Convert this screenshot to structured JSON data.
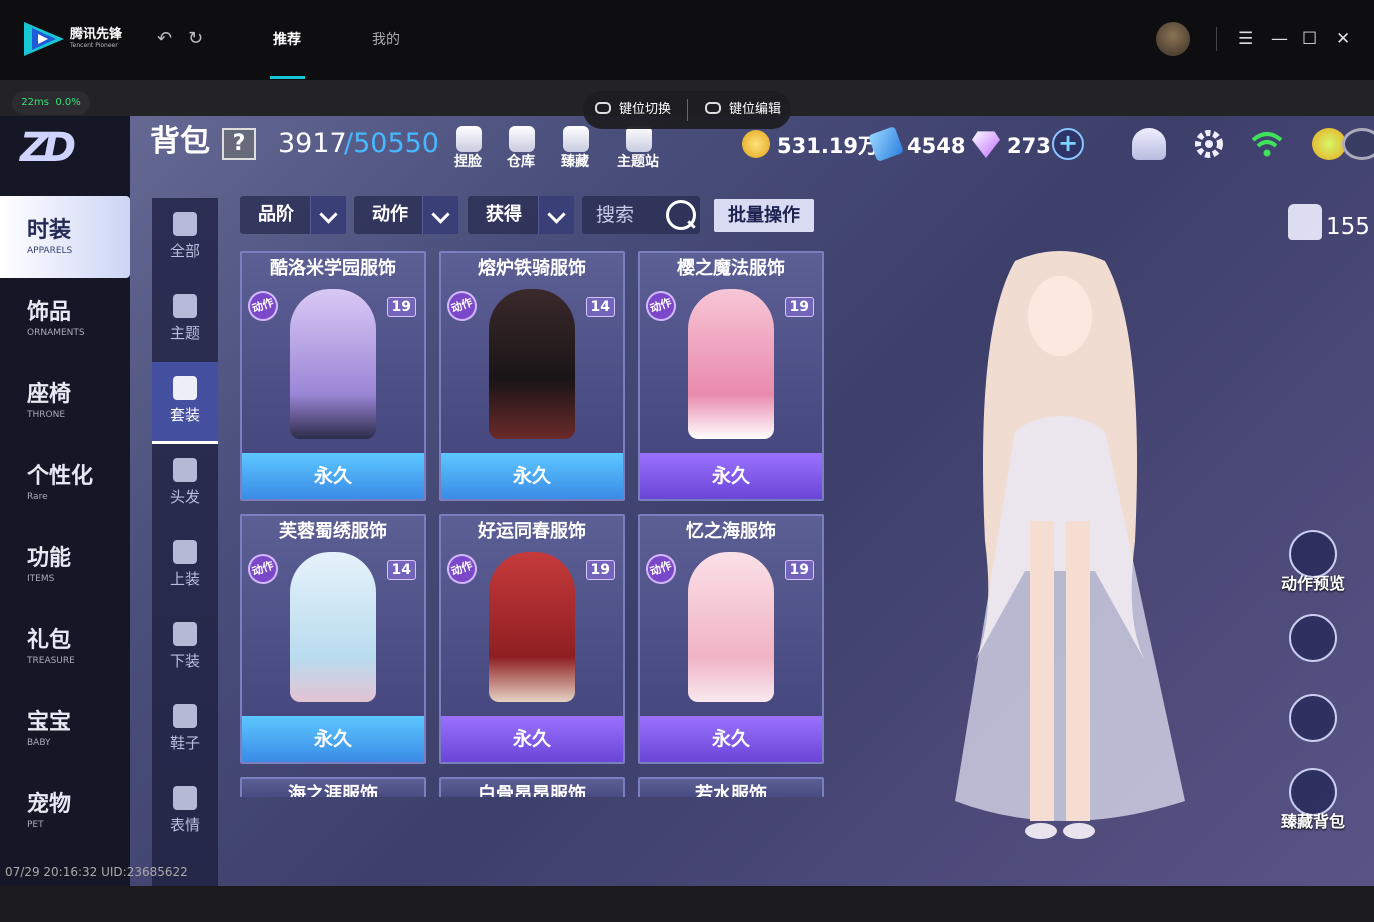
{
  "window": {
    "app_name": "腾讯先锋",
    "app_name_en": "Tencent Pioneer",
    "tabs": [
      {
        "label": "推荐"
      },
      {
        "label": "我的"
      }
    ],
    "ping": "22ms",
    "loss": "0.0%",
    "keymap": {
      "switch_label": "键位切换",
      "edit_label": "键位编辑"
    }
  },
  "game": {
    "bag_title": "背包",
    "help": "?",
    "capacity_used": "3917",
    "capacity_total": "/50550",
    "top_icons": [
      {
        "label": "捏脸"
      },
      {
        "label": "仓库"
      },
      {
        "label": "臻藏"
      },
      {
        "label": "主题站"
      }
    ],
    "currency": {
      "gold": "531.19万",
      "coupon": "4548",
      "diamond": "273",
      "plus": "+"
    },
    "categories": [
      {
        "zh": "时装",
        "en": "APPARELS"
      },
      {
        "zh": "饰品",
        "en": "ORNAMENTS"
      },
      {
        "zh": "座椅",
        "en": "THRONE"
      },
      {
        "zh": "个性化",
        "en": "Rare"
      },
      {
        "zh": "功能",
        "en": "ITEMS"
      },
      {
        "zh": "礼包",
        "en": "TREASURE"
      },
      {
        "zh": "宝宝",
        "en": "BABY"
      },
      {
        "zh": "宠物",
        "en": "PET"
      }
    ],
    "subnav": [
      {
        "label": "全部"
      },
      {
        "label": "主题"
      },
      {
        "label": "套装"
      },
      {
        "label": "头发"
      },
      {
        "label": "上装"
      },
      {
        "label": "下装"
      },
      {
        "label": "鞋子"
      },
      {
        "label": "表情"
      }
    ],
    "filters": [
      {
        "label": "品阶"
      },
      {
        "label": "动作"
      },
      {
        "label": "获得"
      }
    ],
    "search_placeholder": "搜索",
    "batch_label": "批量操作",
    "items": [
      {
        "name": "酷洛米学园服饰",
        "badge": "动作",
        "level": "19",
        "perm": "永久",
        "color": "#b9a6e8"
      },
      {
        "name": "熔炉铁骑服饰",
        "badge": "动作",
        "level": "14",
        "perm": "永久",
        "color": "#2a2224"
      },
      {
        "name": "樱之魔法服饰",
        "badge": "动作",
        "level": "19",
        "perm": "永久",
        "color": "#f2a7c0"
      },
      {
        "name": "芙蓉蜀绣服饰",
        "badge": "动作",
        "level": "14",
        "perm": "永久",
        "color": "#cfe6f2"
      },
      {
        "name": "好运同春服饰",
        "badge": "动作",
        "level": "19",
        "perm": "永久",
        "color": "#b22a2a"
      },
      {
        "name": "忆之海服饰",
        "badge": "动作",
        "level": "19",
        "perm": "永久",
        "color": "#f4c8d6"
      },
      {
        "name": "海之涯服饰"
      },
      {
        "name": "白骨昂昂服饰"
      },
      {
        "name": "若水服饰"
      }
    ],
    "outfit_count": "155",
    "side_buttons": [
      {
        "label": "动作预览"
      },
      {
        "label": ""
      },
      {
        "label": ""
      },
      {
        "label": "臻藏背包"
      }
    ],
    "uid_line": "07/29 20:16:32 UID:23685622"
  }
}
